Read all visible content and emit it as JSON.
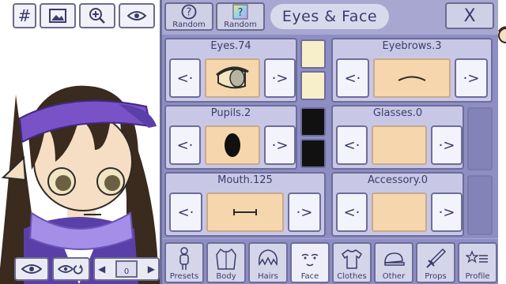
{
  "toolbar": {
    "grid_label": "#"
  },
  "header": {
    "random_label": "Random",
    "random2_label": "Random",
    "title": "Eyes & Face",
    "close_label": "X"
  },
  "cards": {
    "eyes": "Eyes.74",
    "eyebrows": "Eyebrows.3",
    "pupils": "Pupils.2",
    "glasses": "Glasses.0",
    "mouth": "Mouth.125",
    "accessory": "Accessory.0"
  },
  "arrows": {
    "prev": "<·",
    "next": "·>"
  },
  "bottom": {
    "layer_number": "0"
  },
  "tabs": [
    {
      "label": "Presets"
    },
    {
      "label": "Body"
    },
    {
      "label": "Hairs"
    },
    {
      "label": "Face"
    },
    {
      "label": "Clothes"
    },
    {
      "label": "Other"
    },
    {
      "label": "Props"
    },
    {
      "label": "Profile"
    }
  ],
  "colors": {
    "panel": "#a7a7d2",
    "card": "#c8c8e6",
    "skin": "#f6d6ad",
    "eye_swatch": "#f7efc9",
    "pupil_swatch": "#111111",
    "hair": "#3b2a1e",
    "visor": "#7a52c8",
    "scarf": "#a58ee8"
  },
  "icons": {
    "presets": "mannequin-icon",
    "body": "jacket-icon",
    "hairs": "hair-icon",
    "face": "face-icon",
    "clothes": "shirt-icon",
    "other": "cap-icon",
    "props": "sword-icon",
    "profile": "star-list-icon"
  }
}
